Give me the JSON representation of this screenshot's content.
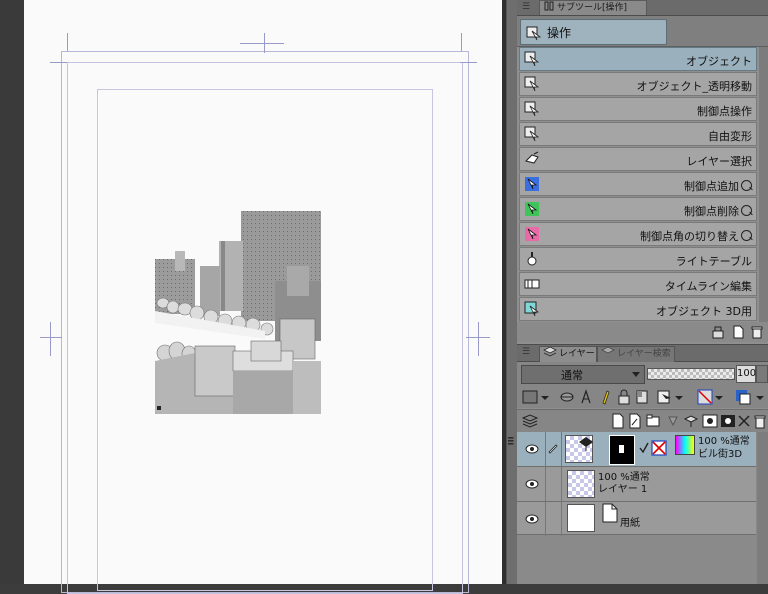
{
  "subtool_panel": {
    "tab_label": "サブツール[操作]",
    "group_label": "操作",
    "tools": [
      {
        "label": "オブジェクト",
        "icon": "object-cursor-icon",
        "selected": true,
        "has_option": false
      },
      {
        "label": "オブジェクト_透明移動",
        "icon": "object-cursor-icon",
        "selected": false,
        "has_option": false
      },
      {
        "label": "制御点操作",
        "icon": "object-cursor-icon",
        "selected": false,
        "has_option": false
      },
      {
        "label": "自由変形",
        "icon": "object-cursor-icon",
        "selected": false,
        "has_option": false
      },
      {
        "label": "レイヤー選択",
        "icon": "layer-select-hand-icon",
        "selected": false,
        "has_option": false
      },
      {
        "label": "制御点追加",
        "icon": "add-point-arrow-icon",
        "selected": false,
        "has_option": true
      },
      {
        "label": "制御点削除",
        "icon": "delete-point-arrow-icon",
        "selected": false,
        "has_option": true
      },
      {
        "label": "制御点角の切り替え",
        "icon": "corner-point-arrow-icon",
        "selected": false,
        "has_option": true
      },
      {
        "label": "ライトテーブル",
        "icon": "light-bulb-icon",
        "selected": false,
        "has_option": false
      },
      {
        "label": "タイムライン編集",
        "icon": "timeline-icon",
        "selected": false,
        "has_option": false
      },
      {
        "label": "オブジェクト 3D用",
        "icon": "object-3d-cursor-icon",
        "selected": false,
        "has_option": false
      }
    ]
  },
  "layer_panel": {
    "tabs": [
      {
        "label": "レイヤー",
        "active": true
      },
      {
        "label": "レイヤー検索",
        "active": false
      }
    ],
    "blend_mode": "通常",
    "opacity": "100",
    "layers": [
      {
        "opacity_mode": "100 %通常",
        "name": "ビル街3D",
        "selected": true,
        "type": "3d"
      },
      {
        "opacity_mode": "100 %通常",
        "name": "レイヤー 1",
        "selected": false,
        "type": "raster"
      },
      {
        "opacity_mode": "",
        "name": "用紙",
        "selected": false,
        "type": "paper"
      }
    ]
  },
  "colors": {
    "selected_bg": "#9ab0bd",
    "panel_bg": "#8f8f8f",
    "canvas_bg": "#fafafa"
  }
}
